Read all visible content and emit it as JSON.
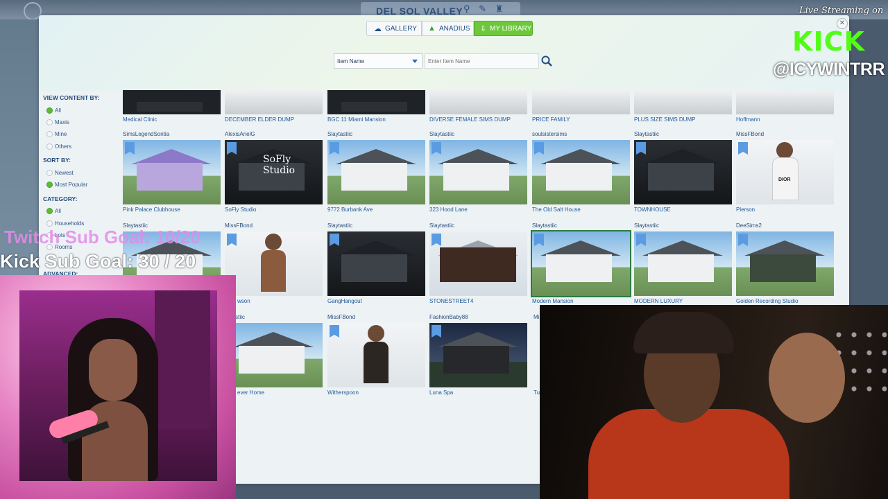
{
  "world": {
    "title": "DEL SOL VALLEY"
  },
  "tabs": [
    {
      "label": "GALLERY",
      "icon": "cloud-icon"
    },
    {
      "label": "ANADIUS",
      "icon": "plumbob-icon"
    },
    {
      "label": "MY LIBRARY",
      "icon": "download-icon",
      "active": true
    }
  ],
  "search": {
    "filter_value": "Item Name",
    "placeholder": "Enter Item Name"
  },
  "sidebar": {
    "view_heading": "VIEW CONTENT BY:",
    "view_options": [
      {
        "label": "All",
        "selected": true
      },
      {
        "label": "Maxis",
        "selected": false
      },
      {
        "label": "Mine",
        "selected": false
      },
      {
        "label": "Others",
        "selected": false
      }
    ],
    "sort_heading": "SORT BY:",
    "sort_options": [
      {
        "label": "Newest",
        "selected": false
      },
      {
        "label": "Most Popular",
        "selected": true
      }
    ],
    "category_heading": "CATEGORY:",
    "category_options": [
      {
        "label": "All",
        "selected": true
      },
      {
        "label": "Households",
        "selected": false
      },
      {
        "label": "Lots",
        "selected": false
      },
      {
        "label": "Rooms",
        "selected": false
      }
    ],
    "advanced_heading": "ADVANCED:"
  },
  "rows": [
    {
      "items": [
        {
          "name": "Medical Clinic",
          "creator": ""
        },
        {
          "name": "DECEMBER ELDER DUMP",
          "creator": ""
        },
        {
          "name": "BGC 11 Miami Mansion",
          "creator": ""
        },
        {
          "name": "DIVERSE FEMALE SIMS DUMP",
          "creator": ""
        },
        {
          "name": "PRICE FAMILY",
          "creator": ""
        },
        {
          "name": "PLUS SIZE SIMS DUMP",
          "creator": ""
        },
        {
          "name": "Hoffmann",
          "creator": ""
        }
      ]
    },
    {
      "items": [
        {
          "creator": "SimsLegendSontia",
          "name": "Pink Palace Clubhouse"
        },
        {
          "creator": "AlexisArielG",
          "name": "SoFly Studio",
          "sign": "SoFly Studio"
        },
        {
          "creator": "Slaytastiic",
          "name": "9772 Burbank Ave"
        },
        {
          "creator": "Slaytastiic",
          "name": "323 Hood Lane"
        },
        {
          "creator": "soulsistersims",
          "name": "The Old Salt House"
        },
        {
          "creator": "Slaytastiic",
          "name": "TOWNHOUSE"
        },
        {
          "creator": "MissFBond",
          "name": "Pierson",
          "sweater": "DIOR"
        }
      ]
    },
    {
      "items": [
        {
          "creator": "Slaytastiic",
          "name": "Dawson"
        },
        {
          "creator": "MissFBond",
          "name": ""
        },
        {
          "creator": "Slaytastiic",
          "name": "GangHangout"
        },
        {
          "creator": "Slaytastiic",
          "name": "STONESTREET4"
        },
        {
          "creator": "Slaytastiic",
          "name": "Modern Mansion"
        },
        {
          "creator": "Slaytastiic",
          "name": "MODERN LUXURY"
        },
        {
          "creator": "DeeSims2",
          "name": "Golden Recording Studio"
        }
      ]
    },
    {
      "items": [
        {
          "creator": "Slaytastiic",
          "name": "Forever Home"
        },
        {
          "creator": "MissFBond",
          "name": "Witherspoon"
        },
        {
          "creator": "FashionBaby88",
          "name": "Luna Spa"
        }
      ]
    }
  ],
  "row3_cut_labels": {
    "creator_left": "Slaytastiic",
    "name_left": "wson",
    "creator_right": "Mi",
    "name_right": "Tu"
  },
  "row4_cut_labels": {
    "creator_left": "aytastiic",
    "name_left": "ever Home"
  },
  "stream": {
    "twitch_goal": "Twitch Sub Goal: 10/20",
    "kick_goal": "Kick Sub Goal: 30 / 20",
    "live_text": "Live Streaming on",
    "kick_logo": "KICK",
    "handle": "@ICYWINTRR"
  },
  "colors": {
    "accent_green": "#6dc93b",
    "link_blue": "#1f5a99",
    "kick_green": "#53fc18"
  }
}
